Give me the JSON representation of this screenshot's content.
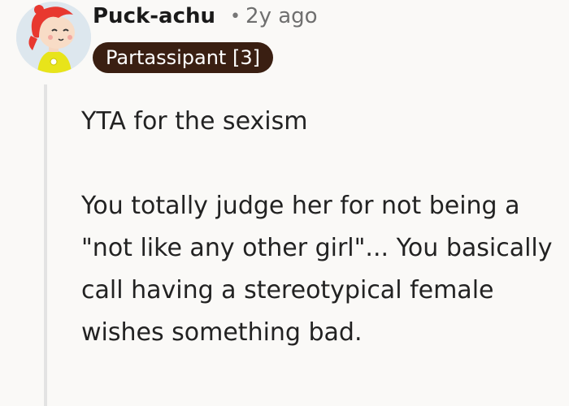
{
  "comment": {
    "username": "Puck-achu",
    "separator": "•",
    "timestamp": "2y ago",
    "flair": "Partassipant [3]",
    "paragraphs": [
      "YTA for the sexism",
      "You totally judge her for not being a \"not like any other girl\"... You basically call having a stereotypical female wishes something bad."
    ]
  },
  "colors": {
    "background": "#faf9f7",
    "flair_background": "#3a1f12",
    "flair_text": "#ffffff",
    "thread_line": "#e3e3e3"
  },
  "icons": {
    "avatar": "avatar-icon"
  }
}
